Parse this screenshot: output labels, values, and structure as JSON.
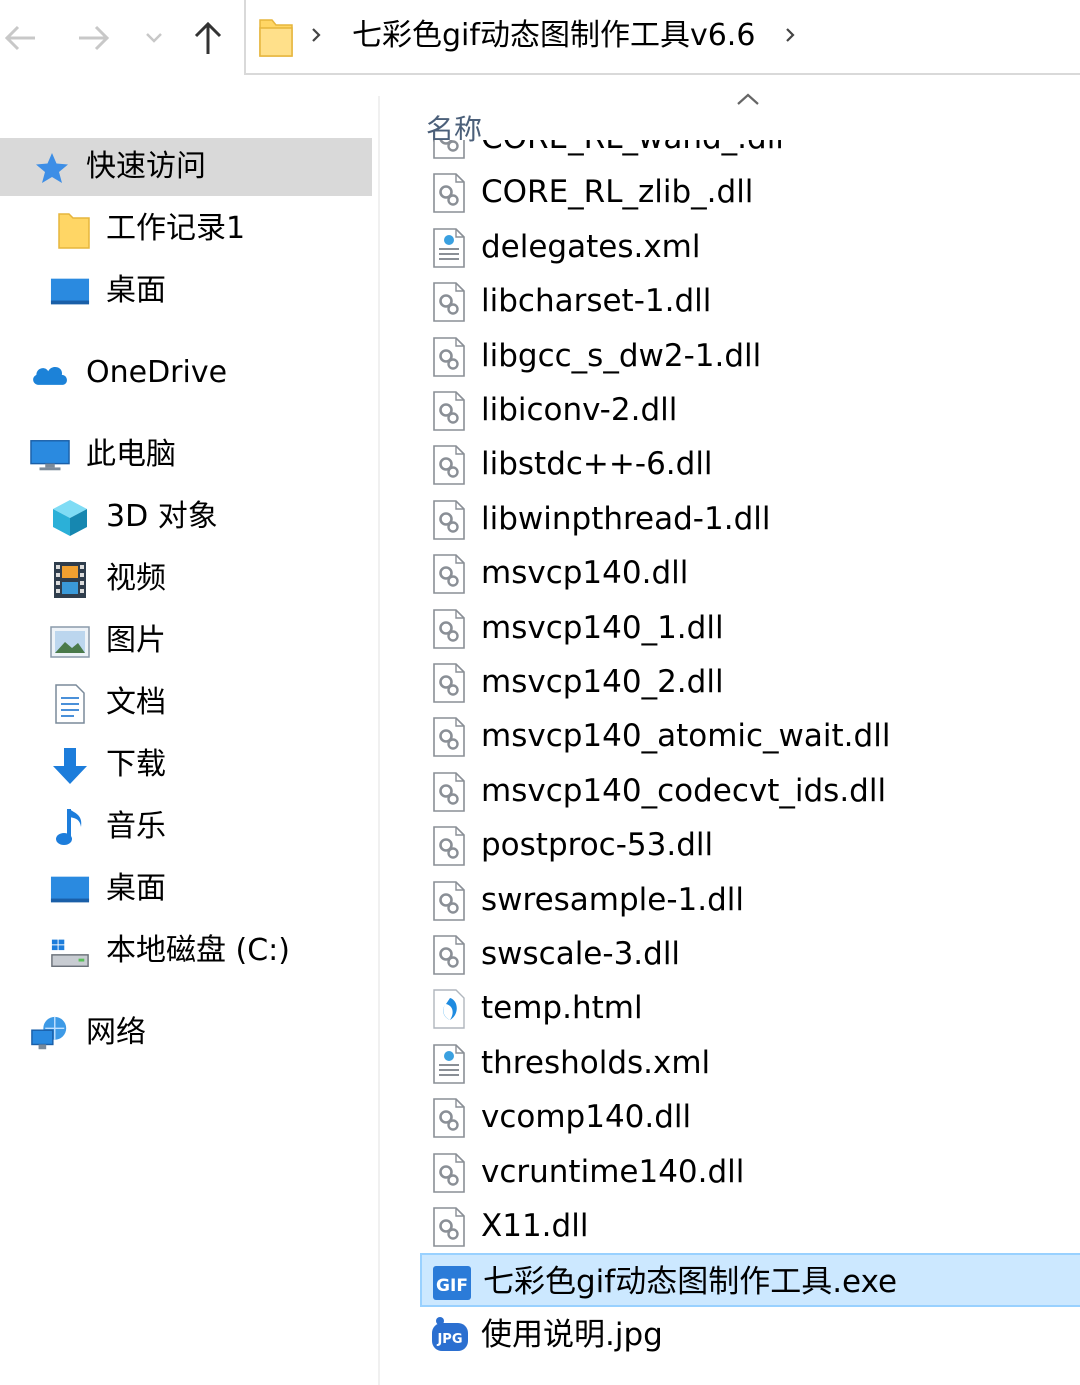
{
  "toolbar": {
    "back_icon": "arrow-left-icon",
    "forward_icon": "arrow-right-icon",
    "recent_icon": "chevron-down-icon",
    "up_icon": "arrow-up-icon",
    "breadcrumb": "七彩色gif动态图制作工具v6.6"
  },
  "nav": {
    "items": [
      {
        "label": "快速访问",
        "icon": "star-icon"
      },
      {
        "label": "工作记录1",
        "icon": "folder-icon"
      },
      {
        "label": "桌面",
        "icon": "desktop-icon"
      },
      {
        "label": "OneDrive",
        "icon": "cloud-icon"
      },
      {
        "label": "此电脑",
        "icon": "computer-icon"
      },
      {
        "label": "3D 对象",
        "icon": "cube-icon"
      },
      {
        "label": "视频",
        "icon": "film-icon"
      },
      {
        "label": "图片",
        "icon": "picture-icon"
      },
      {
        "label": "文档",
        "icon": "document-icon"
      },
      {
        "label": "下载",
        "icon": "download-icon"
      },
      {
        "label": "音乐",
        "icon": "music-icon"
      },
      {
        "label": "桌面",
        "icon": "desktop-icon"
      },
      {
        "label": "本地磁盘 (C:)",
        "icon": "drive-icon"
      },
      {
        "label": "网络",
        "icon": "network-icon"
      }
    ]
  },
  "list": {
    "column_name": "名称",
    "files": [
      {
        "name": "CORE_RL_wand_.dll",
        "icon": "dll-icon"
      },
      {
        "name": "CORE_RL_zlib_.dll",
        "icon": "dll-icon"
      },
      {
        "name": "delegates.xml",
        "icon": "xml-icon"
      },
      {
        "name": "libcharset-1.dll",
        "icon": "dll-icon"
      },
      {
        "name": "libgcc_s_dw2-1.dll",
        "icon": "dll-icon"
      },
      {
        "name": "libiconv-2.dll",
        "icon": "dll-icon"
      },
      {
        "name": "libstdc++-6.dll",
        "icon": "dll-icon"
      },
      {
        "name": "libwinpthread-1.dll",
        "icon": "dll-icon"
      },
      {
        "name": "msvcp140.dll",
        "icon": "dll-icon"
      },
      {
        "name": "msvcp140_1.dll",
        "icon": "dll-icon"
      },
      {
        "name": "msvcp140_2.dll",
        "icon": "dll-icon"
      },
      {
        "name": "msvcp140_atomic_wait.dll",
        "icon": "dll-icon"
      },
      {
        "name": "msvcp140_codecvt_ids.dll",
        "icon": "dll-icon"
      },
      {
        "name": "postproc-53.dll",
        "icon": "dll-icon"
      },
      {
        "name": "swresample-1.dll",
        "icon": "dll-icon"
      },
      {
        "name": "swscale-3.dll",
        "icon": "dll-icon"
      },
      {
        "name": "temp.html",
        "icon": "html-icon"
      },
      {
        "name": "thresholds.xml",
        "icon": "xml-icon"
      },
      {
        "name": "vcomp140.dll",
        "icon": "dll-icon"
      },
      {
        "name": "vcruntime140.dll",
        "icon": "dll-icon"
      },
      {
        "name": "X11.dll",
        "icon": "dll-icon"
      },
      {
        "name": "七彩色gif动态图制作工具.exe",
        "icon": "gif-exe-icon",
        "selected": true
      },
      {
        "name": "使用说明.jpg",
        "icon": "jpg-icon"
      }
    ]
  },
  "colors": {
    "selection_bg": "#cce8ff",
    "selection_border": "#99d1ff",
    "nav_selected": "#d9d9d9",
    "column_header": "#4c607a"
  }
}
